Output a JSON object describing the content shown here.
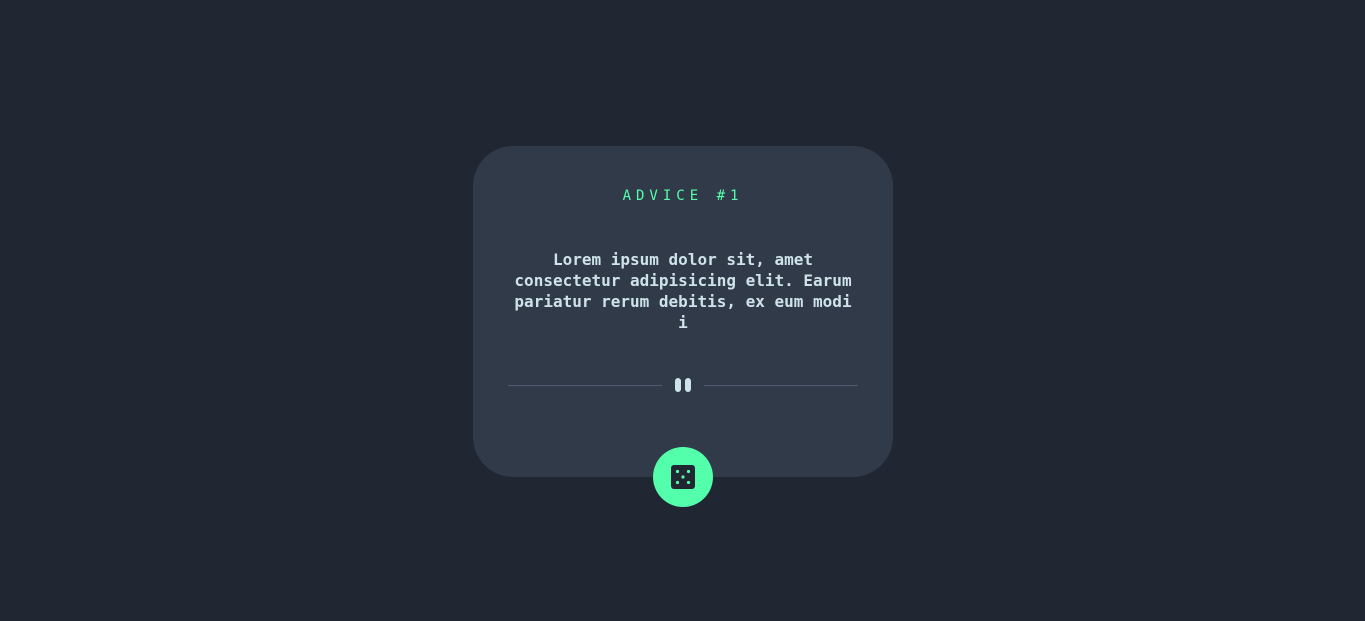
{
  "card": {
    "advice_label": "ADVICE #1",
    "advice_text": "Lorem ipsum dolor sit, amet consectetur adipisicing elit. Earum pariatur rerum debitis, ex eum modi i"
  },
  "icons": {
    "divider": "pause-icon",
    "button": "dice-icon"
  },
  "colors": {
    "background": "#202632",
    "card": "#313a49",
    "accent": "#53ffaa",
    "text": "#cee3e9",
    "divider": "#4f5d74"
  }
}
